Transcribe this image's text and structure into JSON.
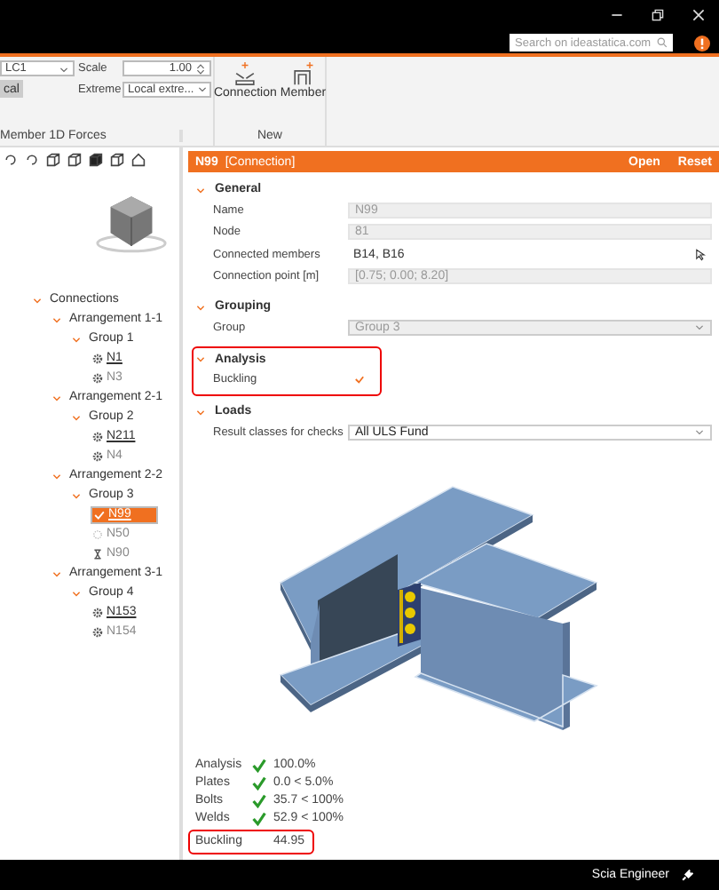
{
  "titlebar": {
    "search": {
      "placeholder": "Search on ideastatica.com"
    }
  },
  "ribbon": {
    "load_case": "LC1",
    "mode_button": "cal",
    "scale_label": "Scale",
    "scale_value": "1.00",
    "extreme_label": "Extreme",
    "extreme_value": "Local extre...",
    "group_label": "Member 1D Forces",
    "new_group": {
      "label": "New",
      "buttons": [
        {
          "label": "Connection",
          "kind": "connection"
        },
        {
          "label": "Member",
          "kind": "member"
        }
      ]
    }
  },
  "tree": [
    {
      "label": "Connections",
      "expanded": true,
      "children": [
        {
          "label": "Arrangement 1-1",
          "expanded": true,
          "children": [
            {
              "label": "Group 1",
              "expanded": true,
              "children": [
                {
                  "label": "N1",
                  "kind": "gear",
                  "linked": true,
                  "selected": false
                },
                {
                  "label": "N3",
                  "kind": "gear",
                  "linked": false,
                  "selected": false
                }
              ]
            }
          ]
        },
        {
          "label": "Arrangement 2-1",
          "expanded": true,
          "children": [
            {
              "label": "Group 2",
              "expanded": true,
              "children": [
                {
                  "label": "N211",
                  "kind": "gear",
                  "linked": true,
                  "selected": false
                },
                {
                  "label": "N4",
                  "kind": "gear",
                  "linked": false,
                  "selected": false
                }
              ]
            }
          ]
        },
        {
          "label": "Arrangement 2-2",
          "expanded": true,
          "children": [
            {
              "label": "Group 3",
              "expanded": true,
              "children": [
                {
                  "label": "N99",
                  "kind": "check",
                  "linked": true,
                  "selected": true
                },
                {
                  "label": "N50",
                  "kind": "spinner",
                  "linked": false,
                  "selected": false
                },
                {
                  "label": "N90",
                  "kind": "hourglass",
                  "linked": false,
                  "selected": false
                }
              ]
            }
          ]
        },
        {
          "label": "Arrangement 3-1",
          "expanded": true,
          "children": [
            {
              "label": "Group 4",
              "expanded": true,
              "children": [
                {
                  "label": "N153",
                  "kind": "gear",
                  "linked": true,
                  "selected": false
                },
                {
                  "label": "N154",
                  "kind": "gear",
                  "linked": false,
                  "selected": false
                }
              ]
            }
          ]
        }
      ]
    }
  ],
  "panel": {
    "title": "N99",
    "subtitle": "[Connection]",
    "actions": [
      "Open",
      "Reset"
    ],
    "sections": [
      {
        "title": "General",
        "expanded": true,
        "highlighted": false,
        "rows": [
          {
            "label": "Name",
            "kind": "readonly",
            "value": "N99"
          },
          {
            "label": "Node",
            "kind": "readonly",
            "value": "81"
          },
          {
            "label": "Connected members",
            "kind": "picker",
            "value": "B14, B16"
          },
          {
            "label": "Connection point [m]",
            "kind": "readonly",
            "value": "[0.75; 0.00; 8.20]"
          }
        ]
      },
      {
        "title": "Grouping",
        "expanded": true,
        "highlighted": false,
        "rows": [
          {
            "label": "Group",
            "kind": "select",
            "value": "Group 3",
            "disabled": true
          }
        ]
      },
      {
        "title": "Analysis",
        "expanded": true,
        "highlighted": true,
        "rows": [
          {
            "label": "Buckling",
            "kind": "checkbox",
            "checked": true
          }
        ]
      },
      {
        "title": "Loads",
        "expanded": true,
        "highlighted": false,
        "rows": [
          {
            "label": "Result classes for checks",
            "kind": "select",
            "value": "All ULS Fund",
            "disabled": false
          }
        ]
      }
    ]
  },
  "results": [
    {
      "label": "Analysis",
      "kind": "check",
      "value": "100.0%",
      "highlighted": false
    },
    {
      "label": "Plates",
      "kind": "check",
      "value": "0.0 < 5.0%",
      "highlighted": false
    },
    {
      "label": "Bolts",
      "kind": "check",
      "value": "35.7 < 100%",
      "highlighted": false
    },
    {
      "label": "Welds",
      "kind": "check",
      "value": "52.9 < 100%",
      "highlighted": false
    },
    {
      "label": "Buckling",
      "kind": "value",
      "value": "44.95",
      "highlighted": true
    }
  ],
  "status_bar": {
    "product": "Scia Engineer"
  }
}
